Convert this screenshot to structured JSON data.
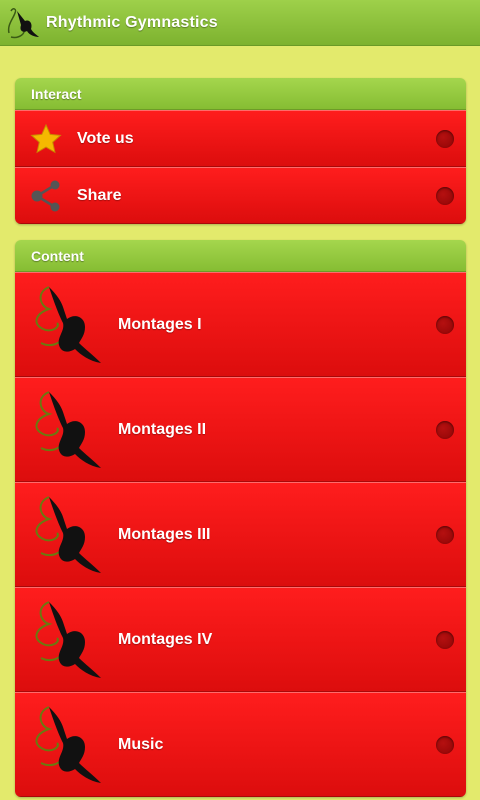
{
  "app": {
    "title": "Rhythmic Gymnastics",
    "icon": "gymnast-ribbon-icon"
  },
  "interact": {
    "header": "Interact",
    "items": [
      {
        "label": "Vote us",
        "icon": "star-icon"
      },
      {
        "label": "Share",
        "icon": "share-icon"
      }
    ]
  },
  "content": {
    "header": "Content",
    "items": [
      {
        "label": "Montages I",
        "icon": "gymnast-ribbon-icon"
      },
      {
        "label": "Montages II",
        "icon": "gymnast-ribbon-icon"
      },
      {
        "label": "Montages III",
        "icon": "gymnast-ribbon-icon"
      },
      {
        "label": "Montages IV",
        "icon": "gymnast-ribbon-icon"
      },
      {
        "label": "Music",
        "icon": "gymnast-ribbon-icon"
      }
    ]
  },
  "colors": {
    "background": "#e3ea6c",
    "header_green": "#8cc63f",
    "row_red": "#ee1414",
    "star": "#f5b800"
  }
}
